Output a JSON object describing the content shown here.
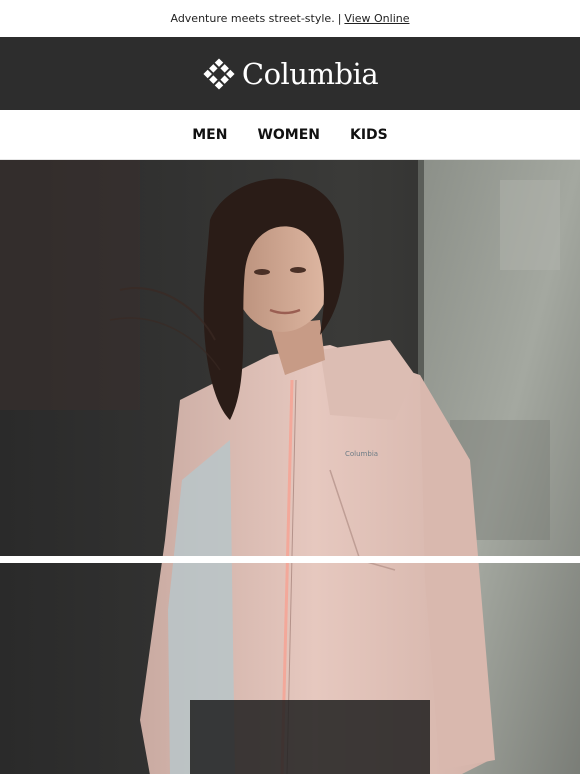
{
  "preheader": {
    "text": "Adventure meets street-style.",
    "separator": "|",
    "link_label": "View Online"
  },
  "brand": {
    "name": "Columbia",
    "icon": "columbia-diamond-logo-icon",
    "bar_color": "#2d2d2d"
  },
  "nav": {
    "items": [
      {
        "label": "MEN"
      },
      {
        "label": "WOMEN"
      },
      {
        "label": "KIDS"
      }
    ]
  },
  "hero": {
    "image": "woman-in-pink-rain-jacket-photo",
    "jacket_logo": "Columbia"
  }
}
